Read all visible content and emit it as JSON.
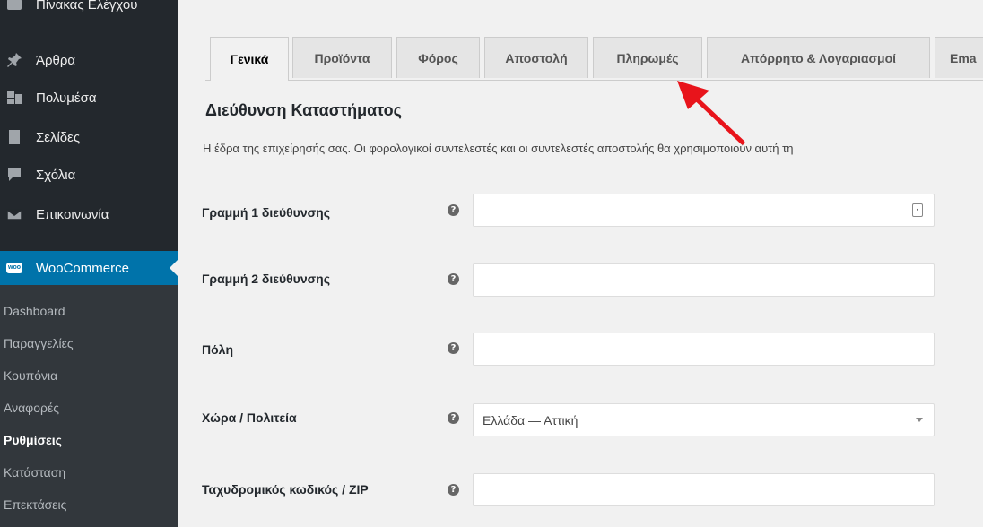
{
  "sidebar": {
    "top_item": "Πίνακας Ελέγχου",
    "items": [
      {
        "label": "Άρθρα",
        "icon": "pin-icon"
      },
      {
        "label": "Πολυμέσα",
        "icon": "media-icon"
      },
      {
        "label": "Σελίδες",
        "icon": "page-icon"
      },
      {
        "label": "Σχόλια",
        "icon": "comment-icon"
      },
      {
        "label": "Επικοινωνία",
        "icon": "mail-icon"
      }
    ],
    "woocommerce": {
      "label": "WooCommerce",
      "icon": "woo-icon",
      "icon_text": "woo"
    },
    "submenu": [
      {
        "label": "Dashboard"
      },
      {
        "label": "Παραγγελίες"
      },
      {
        "label": "Κουπόνια"
      },
      {
        "label": "Αναφορές"
      },
      {
        "label": "Ρυθμίσεις",
        "current": true
      },
      {
        "label": "Κατάσταση"
      },
      {
        "label": "Επεκτάσεις"
      }
    ]
  },
  "tabs": [
    {
      "label": "Γενικά",
      "active": true
    },
    {
      "label": "Προϊόντα"
    },
    {
      "label": "Φόρος"
    },
    {
      "label": "Αποστολή"
    },
    {
      "label": "Πληρωμές"
    },
    {
      "label": "Απόρρητο & Λογαριασμοί"
    },
    {
      "label": "Ema"
    }
  ],
  "section": {
    "title": "Διεύθυνση Καταστήματος",
    "description": "Η έδρα της επιχείρησής σας. Οι φορολογικοί συντελεστές και οι συντελεστές αποστολής θα χρησιμοποιούν αυτή τη"
  },
  "fields": [
    {
      "label": "Γραμμή 1 διεύθυνσης",
      "value": "",
      "help": "?"
    },
    {
      "label": "Γραμμή 2 διεύθυνσης",
      "value": "",
      "help": "?"
    },
    {
      "label": "Πόλη",
      "value": "",
      "help": "?"
    },
    {
      "label": "Χώρα / Πολιτεία",
      "value": "Ελλάδα — Αττική",
      "help": "?"
    },
    {
      "label": "Ταχυδρομικός κωδικός / ZIP",
      "value": "",
      "help": "?"
    }
  ],
  "colors": {
    "sidebar_bg": "#23282d",
    "submenu_bg": "#32373c",
    "accent": "#0073aa",
    "arrow": "#e8141b"
  }
}
